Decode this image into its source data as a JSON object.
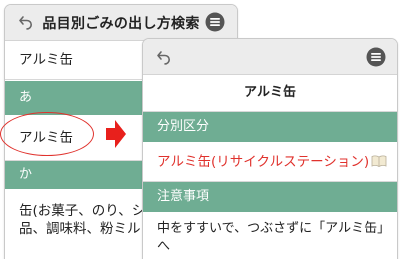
{
  "colors": {
    "accent": "#6fad93",
    "link_red": "#e0322d",
    "bar_bg": "#ececec"
  },
  "left_screen": {
    "header_title": "品目別ごみの出し方検索",
    "rows": {
      "item_top": "アルミ缶",
      "section_a": "あ",
      "item_selected": "アルミ缶",
      "section_ka": "か",
      "item_bottom_line1": "缶(お菓子、のり、シ",
      "item_bottom_line2": "品、調味料、粉ミル"
    }
  },
  "right_screen": {
    "title": "アルミ缶",
    "section_category": "分別区分",
    "category_link": "アルミ缶(リサイクルステーション)",
    "section_notes": "注意事項",
    "note_line1": "中をすすいで、つぶさずに「アルミ缶」",
    "note_line2": "へ"
  },
  "icons": [
    "back-arrow-icon",
    "menu-icon",
    "book-icon",
    "right-arrow-icon"
  ]
}
